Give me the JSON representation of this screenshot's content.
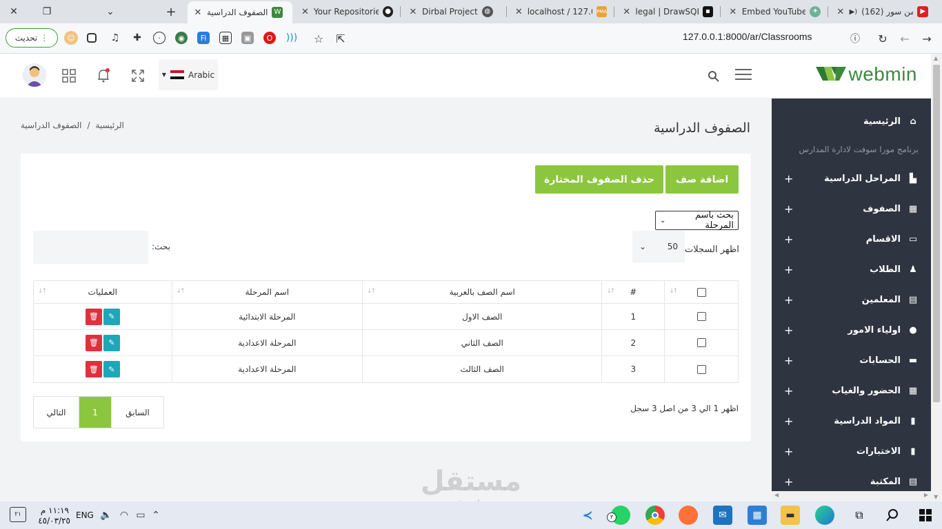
{
  "browser": {
    "tabs": [
      {
        "title": "الصفوف الدراسية",
        "active": true
      },
      {
        "title": "Your Repositories"
      },
      {
        "title": "Dirbal Project"
      },
      {
        "title": "localhost / 127.0."
      },
      {
        "title": "legal | DrawSQL"
      },
      {
        "title": "Embed YouTube"
      },
      {
        "title": "(162) من سور"
      }
    ],
    "refresh_label": "تحديث",
    "url": "127.0.0.1:8000/ar/Classrooms"
  },
  "header": {
    "logo_text": "webmin",
    "language": "Arabic"
  },
  "sidebar": {
    "home": "الرئيسية",
    "heading": "برنامج مورا سوفت لادارة المدارس",
    "items": [
      {
        "label": "المراحل الدراسية",
        "icon": "building-icon"
      },
      {
        "label": "الصفوف",
        "icon": "grid-icon"
      },
      {
        "label": "الاقسام",
        "icon": "monitor-icon"
      },
      {
        "label": "الطلاب",
        "icon": "graduate-icon"
      },
      {
        "label": "المعلمين",
        "icon": "teacher-icon"
      },
      {
        "label": "اولياء الامور",
        "icon": "user-icon"
      },
      {
        "label": "الحسابات",
        "icon": "money-icon"
      },
      {
        "label": "الحضور والغياب",
        "icon": "calendar-icon"
      },
      {
        "label": "المواد الدراسية",
        "icon": "book-icon"
      },
      {
        "label": "الاختبارات",
        "icon": "book-open-icon"
      },
      {
        "label": "المكتبة",
        "icon": "library-icon"
      }
    ],
    "plus": "+"
  },
  "page": {
    "title": "الصفوف الدراسية",
    "breadcrumb_home": "الرئيسية",
    "breadcrumb_sep": "/",
    "breadcrumb_current": "الصفوف الدراسية"
  },
  "toolbar": {
    "add_label": "اضافة صف",
    "delete_selected_label": "حذف الصفوف المختارة",
    "stage_filter_value": "بحث باسم المرحلة",
    "show_label": "اظهر السجلات",
    "show_value": "50",
    "search_label": "بحث:"
  },
  "table": {
    "headers": {
      "num": "#",
      "name_ar": "اسم الصف بالعربية",
      "stage": "اسم المرحلة",
      "actions": "العمليات"
    },
    "rows": [
      {
        "num": "1",
        "name_ar": "الصف الاول",
        "stage": "المرحلة الابتدائية"
      },
      {
        "num": "2",
        "name_ar": "الصف الثاني",
        "stage": "المرحلة الاعدادية"
      },
      {
        "num": "3",
        "name_ar": "الصف الثالث",
        "stage": "المرحلة الاعدادية"
      }
    ]
  },
  "footer": {
    "info": "اظهر 1 الي 3 من اصل 3 سجل",
    "prev": "السابق",
    "current": "1",
    "next": "التالي"
  },
  "watermark": {
    "arabic": "مستقل",
    "latin": "mostaql.com"
  },
  "taskbar": {
    "time": "١١:١٩ م",
    "date": "٤٥/٠٣/٢٥",
    "lang": "ENG",
    "notif_count": "٢١",
    "whatsapp_count": "٣"
  }
}
